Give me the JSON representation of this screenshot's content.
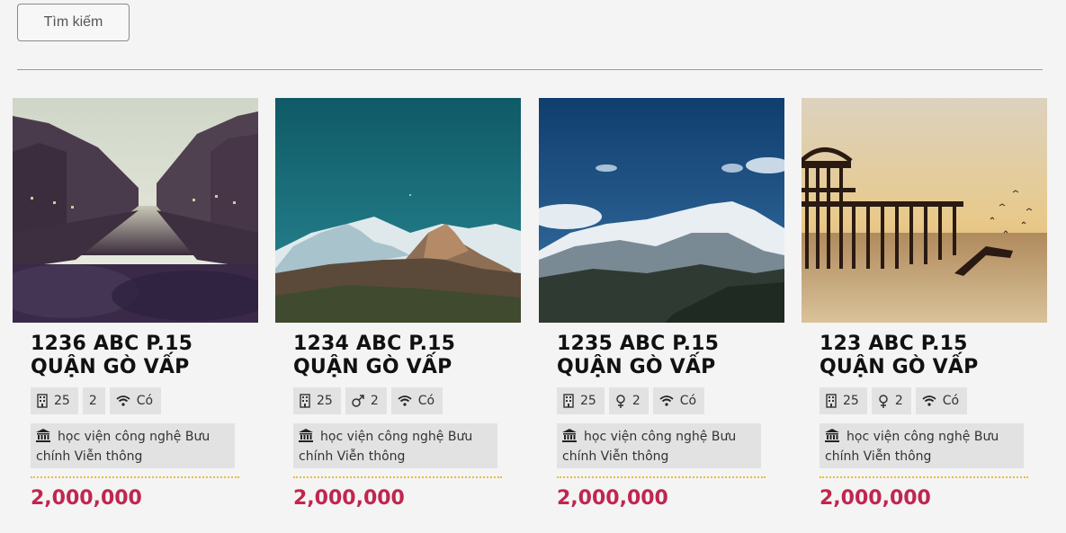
{
  "search": {
    "label": "Tìm kiếm"
  },
  "icons": {
    "area": "building-icon",
    "gender": "gender-icon",
    "wifi": "wifi-icon",
    "place": "institution-icon"
  },
  "colors": {
    "price": "#c0264f",
    "divider_dots": "#e6bf3a"
  },
  "listings": [
    {
      "photo": "canal-city-photo",
      "title": "1236 ABC P.15 QUẬN GÒ VẤP",
      "area": "25",
      "gender_icon": "none",
      "people": "2",
      "wifi": "Có",
      "place": "học viện công nghệ Bưu chính Viễn thông",
      "price": "2,000,000"
    },
    {
      "photo": "mountain-teal-photo",
      "title": "1234 ABC P.15 QUẬN GÒ VẤP",
      "area": "25",
      "gender_icon": "male-icon",
      "people": "2",
      "wifi": "Có",
      "place": "học viện công nghệ Bưu chính Viễn thông",
      "price": "2,000,000"
    },
    {
      "photo": "mountain-blue-photo",
      "title": "1235 ABC P.15 QUẬN GÒ VẤP",
      "area": "25",
      "gender_icon": "female-icon",
      "people": "2",
      "wifi": "Có",
      "place": "học viện công nghệ Bưu chính Viễn thông",
      "price": "2,000,000"
    },
    {
      "photo": "pier-sunset-photo",
      "title": "123 ABC P.15 QUẬN GÒ VẤP",
      "area": "25",
      "gender_icon": "female-icon",
      "people": "2",
      "wifi": "Có",
      "place": "học viện công nghệ Bưu chính Viễn thông",
      "price": "2,000,000"
    }
  ]
}
